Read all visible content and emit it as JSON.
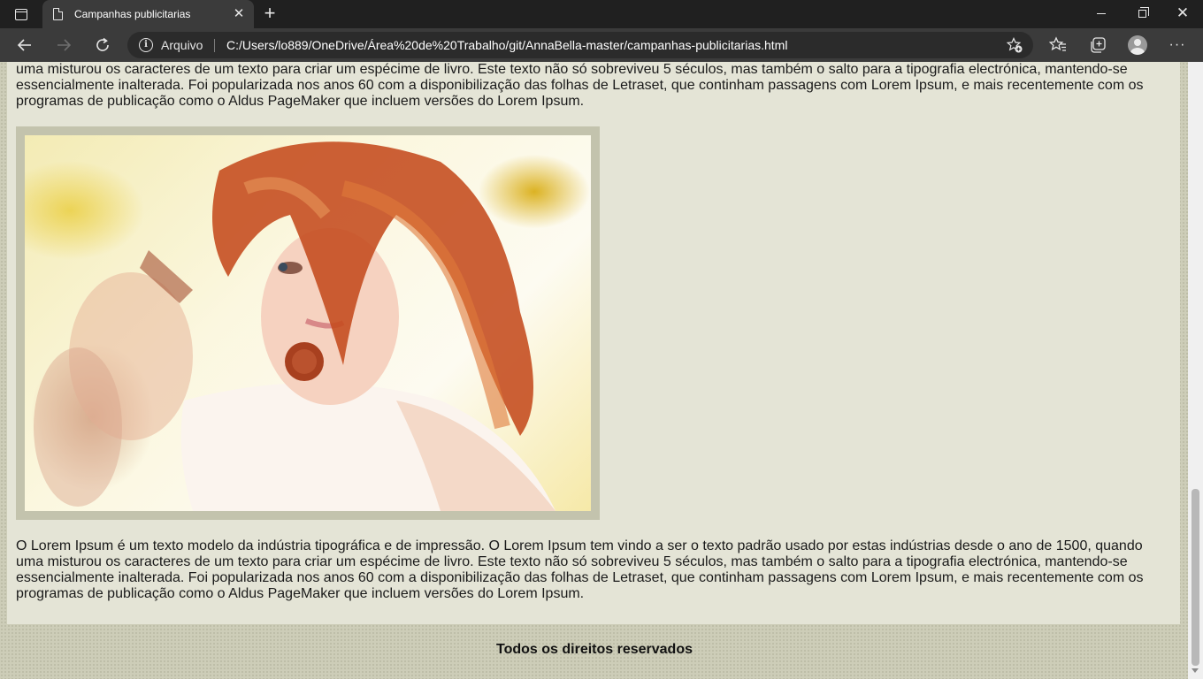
{
  "browser": {
    "tab_title": "Campanhas publicitarias",
    "new_tab_symbol": "+",
    "close_symbol": "✕",
    "site_info_label": "Arquivo",
    "url": "C:/Users/lo889/OneDrive/Área%20de%20Trabalho/git/AnnaBella-master/campanhas-publicitarias.html",
    "more_symbol": "···"
  },
  "page": {
    "paragraph_top": "uma misturou os caracteres de um texto para criar um espécime de livro. Este texto não só sobreviveu 5 séculos, mas também o salto para a tipografia electrónica, mantendo-se essencialmente inalterada. Foi popularizada nos anos 60 com a disponibilização das folhas de Letraset, que continham passagens com Lorem Ipsum, e mais recentemente com os programas de publicação como o Aldus PageMaker que incluem versões do Lorem Ipsum.",
    "paragraph_bottom": "O Lorem Ipsum é um texto modelo da indústria tipográfica e de impressão. O Lorem Ipsum tem vindo a ser o texto padrão usado por estas indústrias desde o ano de 1500, quando uma misturou os caracteres de um texto para criar um espécime de livro. Este texto não só sobreviveu 5 séculos, mas também o salto para a tipografia electrónica, mantendo-se essencialmente inalterada. Foi popularizada nos anos 60 com a disponibilização das folhas de Letraset, que continham passagens com Lorem Ipsum, e mais recentemente com os programas de publicação como o Aldus PageMaker que incluem versões do Lorem Ipsum.",
    "footer": "Todos os direitos reservados"
  },
  "colors": {
    "chrome_dark": "#202020",
    "chrome_toolbar": "#3b3b3b",
    "content_bg": "#e4e4d6",
    "frame": "#c3c3ad"
  }
}
